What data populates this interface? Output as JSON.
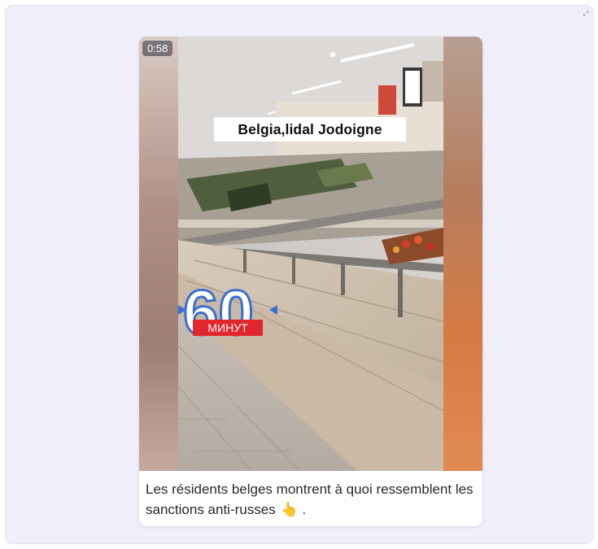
{
  "post": {
    "video": {
      "duration": "0:58",
      "location_label": "Belgia,lidal Jodoigne",
      "channel_logo": {
        "number": "60",
        "word": "МИНУТ"
      }
    },
    "caption": {
      "text": "Les résidents belges montrent à quoi ressemblent les sanctions anti-russes",
      "emoji_icon": "pointing-up-hand-icon",
      "trailing": "."
    }
  },
  "colors": {
    "frame_bg": "#efeef9",
    "logo_blue": "#3c6fcf",
    "logo_red": "#e2262d"
  }
}
